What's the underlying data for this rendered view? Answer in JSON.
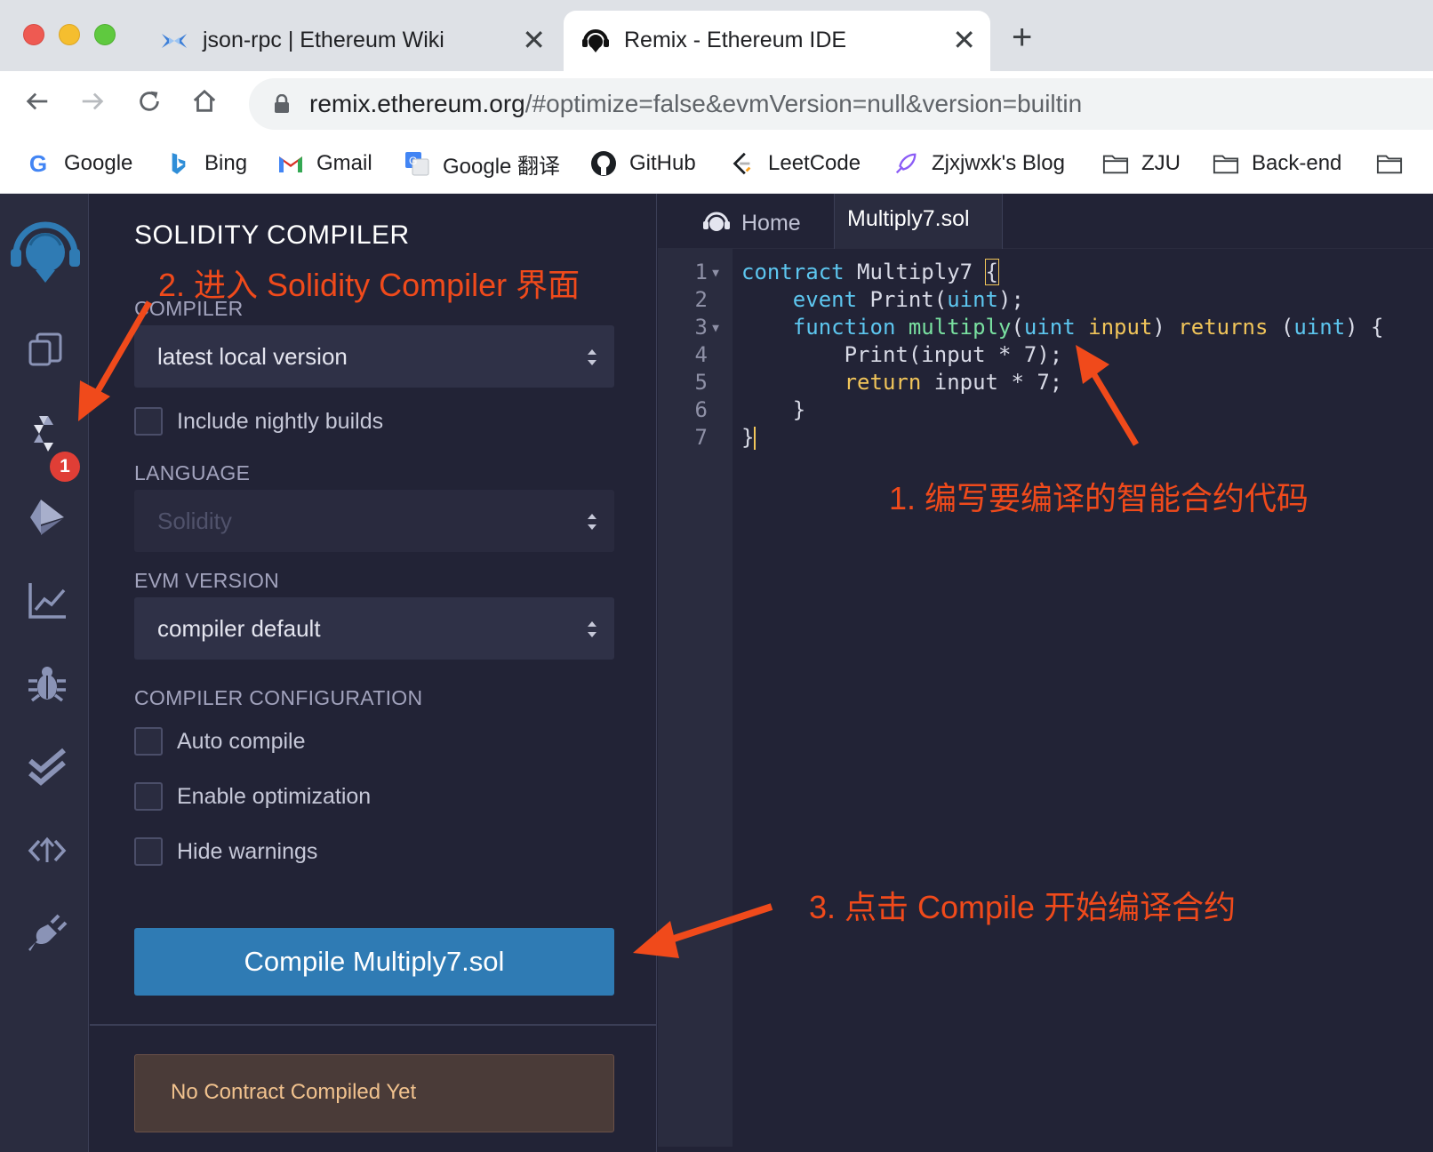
{
  "browser": {
    "tabs": [
      {
        "title": "json-rpc | Ethereum Wiki",
        "active": false,
        "favicon": "ethereum-wiki-icon"
      },
      {
        "title": "Remix - Ethereum IDE",
        "active": true,
        "favicon": "remix-icon"
      }
    ],
    "url_host": "remix.ethereum.org",
    "url_path": "/#optimize=false&evmVersion=null&version=builtin",
    "bookmarks": [
      {
        "label": "Google",
        "icon": "google-icon"
      },
      {
        "label": "Bing",
        "icon": "bing-icon"
      },
      {
        "label": "Gmail",
        "icon": "gmail-icon"
      },
      {
        "label": "Google 翻译",
        "icon": "google-translate-icon"
      },
      {
        "label": "GitHub",
        "icon": "github-icon"
      },
      {
        "label": "LeetCode",
        "icon": "leetcode-icon"
      },
      {
        "label": "Zjxjwxk's Blog",
        "icon": "rocket-icon"
      },
      {
        "label": "ZJU",
        "icon": "folder-icon"
      },
      {
        "label": "Back-end",
        "icon": "folder-icon"
      }
    ]
  },
  "iconbar": {
    "badge": "1"
  },
  "compiler_panel": {
    "title": "SOLIDITY COMPILER",
    "compiler_label": "COMPILER",
    "compiler_value": "latest local version",
    "nightly_label": "Include nightly builds",
    "language_label": "LANGUAGE",
    "language_value": "Solidity",
    "evm_label": "EVM VERSION",
    "evm_value": "compiler default",
    "config_label": "COMPILER CONFIGURATION",
    "auto_compile": "Auto compile",
    "enable_optimization": "Enable optimization",
    "hide_warnings": "Hide warnings",
    "compile_button": "Compile Multiply7.sol",
    "status": "No Contract Compiled Yet"
  },
  "editor": {
    "tabs": [
      {
        "label": "Home",
        "active": false
      },
      {
        "label": "Multiply7.sol",
        "active": true
      }
    ],
    "line_numbers": [
      "1",
      "2",
      "3",
      "4",
      "5",
      "6",
      "7"
    ],
    "code": [
      "contract Multiply7 {",
      "    event Print(uint);",
      "    function multiply(uint input) returns (uint) {",
      "        Print(input * 7);",
      "        return input * 7;",
      "    }",
      "}"
    ]
  },
  "annotations": {
    "step1": "1. 编写要编译的智能合约代码",
    "step2": "2. 进入 Solidity Compiler 界面",
    "step3": "3. 点击 Compile 开始编译合约"
  },
  "colors": {
    "accent": "#2f7bb4",
    "annotation": "#f04a1b",
    "background": "#222336",
    "sidebar": "#2a2c3f"
  }
}
